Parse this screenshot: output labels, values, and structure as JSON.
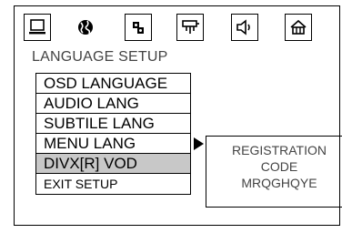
{
  "tabs": [
    {
      "name": "general",
      "icon": "monitor-icon"
    },
    {
      "name": "language",
      "icon": "globe-icon",
      "active": true
    },
    {
      "name": "audio",
      "icon": "speakers-icon"
    },
    {
      "name": "video",
      "icon": "video-plug-icon"
    },
    {
      "name": "speaker",
      "icon": "speaker-icon"
    },
    {
      "name": "preference",
      "icon": "preference-icon"
    }
  ],
  "section_title": "LANGUAGE  SETUP",
  "menu": {
    "items": [
      {
        "label": "OSD LANGUAGE"
      },
      {
        "label": "AUDIO LANG"
      },
      {
        "label": "SUBTILE LANG"
      },
      {
        "label": "MENU  LANG"
      },
      {
        "label": "DIVX[R]  VOD",
        "selected": true
      },
      {
        "label": "EXIT SETUP"
      }
    ]
  },
  "registration": {
    "line1": "REGISTRATION",
    "line2": "CODE",
    "code": "MRQGHQYE"
  },
  "colors": {
    "selected_bg": "#c8c8c8",
    "text_gray": "#444444"
  }
}
